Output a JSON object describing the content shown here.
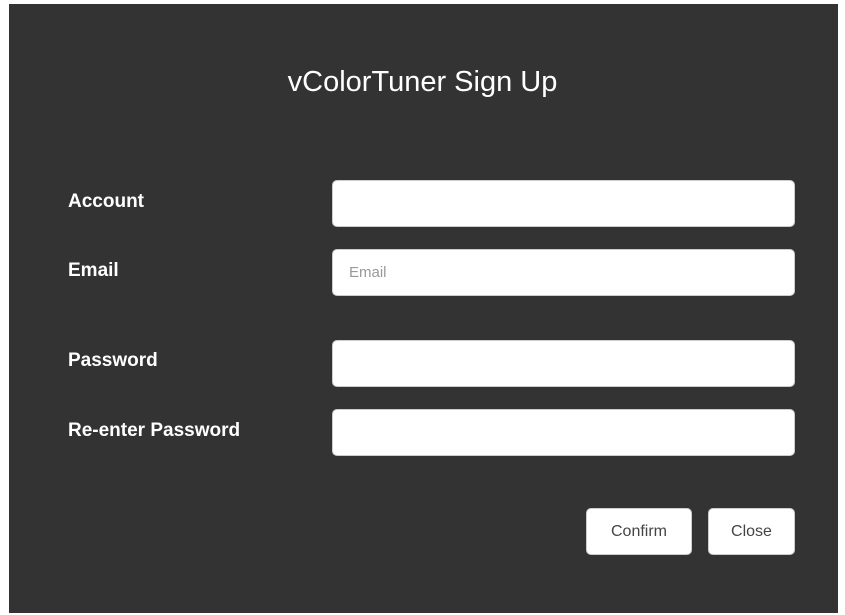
{
  "dialog": {
    "title": "vColorTuner Sign Up",
    "fields": {
      "account": {
        "label": "Account",
        "value": "",
        "placeholder": ""
      },
      "email": {
        "label": "Email",
        "value": "",
        "placeholder": "Email"
      },
      "password": {
        "label": "Password",
        "value": "",
        "placeholder": ""
      },
      "reenter_password": {
        "label": "Re-enter Password",
        "value": "",
        "placeholder": ""
      }
    },
    "buttons": {
      "confirm": "Confirm",
      "close": "Close"
    }
  },
  "colors": {
    "dialog_background": "#333333",
    "text": "#ffffff",
    "input_background": "#ffffff",
    "placeholder": "#999999"
  }
}
